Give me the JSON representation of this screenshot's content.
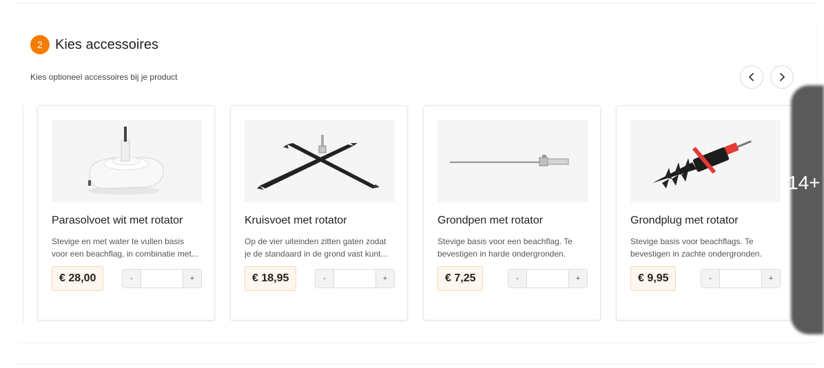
{
  "section": {
    "step_number": "2",
    "title": "Kies accessoires",
    "subtitle": "Kies optioneel accessoires bij je product"
  },
  "carousel": {
    "prev_icon": "chevron-left-icon",
    "next_icon": "chevron-right-icon",
    "more_count": "14+"
  },
  "products": [
    {
      "title": "Parasolvoet wit met rotator",
      "desc_line1": "Stevige en met water te vullen basis",
      "desc_line2": "voor een beachflag, in combinatie met...",
      "price": "€ 28,00",
      "qty_minus": "-",
      "qty_plus": "+",
      "qty_value": ""
    },
    {
      "title": "Kruisvoet met rotator",
      "desc_line1": "Op de vier uiteinden zitten gaten zodat",
      "desc_line2": "je de standaard in de grond vast kunt...",
      "price": "€ 18,95",
      "qty_minus": "-",
      "qty_plus": "+",
      "qty_value": ""
    },
    {
      "title": "Grondpen met rotator",
      "desc_line1": "Stevige basis voor een beachflag. Te",
      "desc_line2": "bevestigen in harde ondergronden.",
      "price": "€ 7,25",
      "qty_minus": "-",
      "qty_plus": "+",
      "qty_value": ""
    },
    {
      "title": "Grondplug met rotator",
      "desc_line1": "Stevige basis voor beachflags. Te",
      "desc_line2": "bevestigen in zachte ondergronden.",
      "price": "€ 9,95",
      "qty_minus": "-",
      "qty_plus": "+",
      "qty_value": ""
    }
  ],
  "colors": {
    "accent": "#f57c00",
    "price_bg": "#fff7ef",
    "price_border": "#f6d6b8"
  }
}
